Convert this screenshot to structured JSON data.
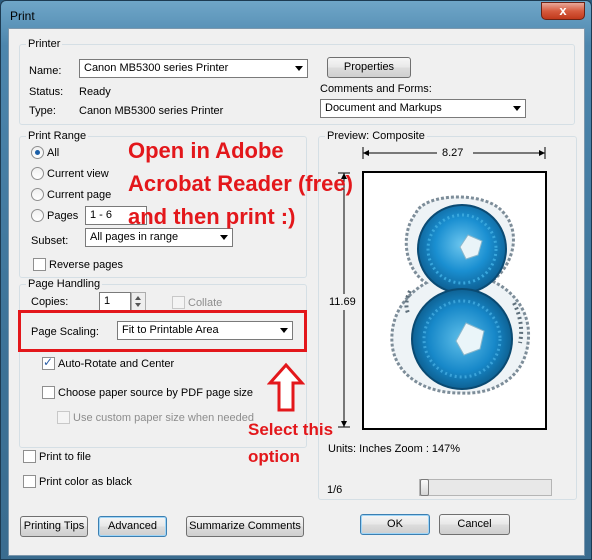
{
  "window": {
    "title": "Print",
    "close_glyph": "x"
  },
  "printer": {
    "legend": "Printer",
    "name_label": "Name:",
    "name_value": "Canon MB5300 series Printer",
    "properties_label": "Properties",
    "status_label": "Status:",
    "status_value": "Ready",
    "type_label": "Type:",
    "type_value": "Canon MB5300 series Printer",
    "comments_label": "Comments and Forms:",
    "comments_value": "Document and Markups"
  },
  "print_range": {
    "legend": "Print Range",
    "options": [
      "All",
      "Current view",
      "Current page",
      "Pages"
    ],
    "selected": "All",
    "pages_value": "1 - 6",
    "subset_label": "Subset:",
    "subset_value": "All pages in range",
    "reverse_label": "Reverse pages"
  },
  "page_handling": {
    "legend": "Page Handling",
    "copies_label": "Copies:",
    "copies_value": "1",
    "collate_label": "Collate",
    "scaling_label": "Page Scaling:",
    "scaling_value": "Fit to Printable Area",
    "autorotate_label": "Auto-Rotate and Center",
    "autorotate_checked": true,
    "paper_source_label": "Choose paper source by PDF page size",
    "custom_paper_label": "Use custom paper size when needed"
  },
  "options": {
    "print_to_file_label": "Print to file",
    "print_color_black_label": "Print color as black"
  },
  "preview": {
    "legend": "Preview: Composite",
    "width_value": "8.27",
    "height_value": "11.69",
    "units_zoom": "Units: Inches Zoom : 147%",
    "page_indicator": "1/6",
    "page_position": 0
  },
  "footer": {
    "printing_tips_label": "Printing Tips",
    "advanced_label": "Advanced",
    "summarize_label": "Summarize Comments",
    "ok_label": "OK",
    "cancel_label": "Cancel"
  },
  "annotations": {
    "headline": [
      "Open in Adobe",
      "Acrobat Reader (free)",
      "and then print :)"
    ],
    "callout": [
      "Select this",
      "option"
    ],
    "highlight_color": "#e3171b"
  },
  "colors": {
    "image_accent": "#1a8fd1",
    "default_button_border": "#3c7fb1"
  }
}
